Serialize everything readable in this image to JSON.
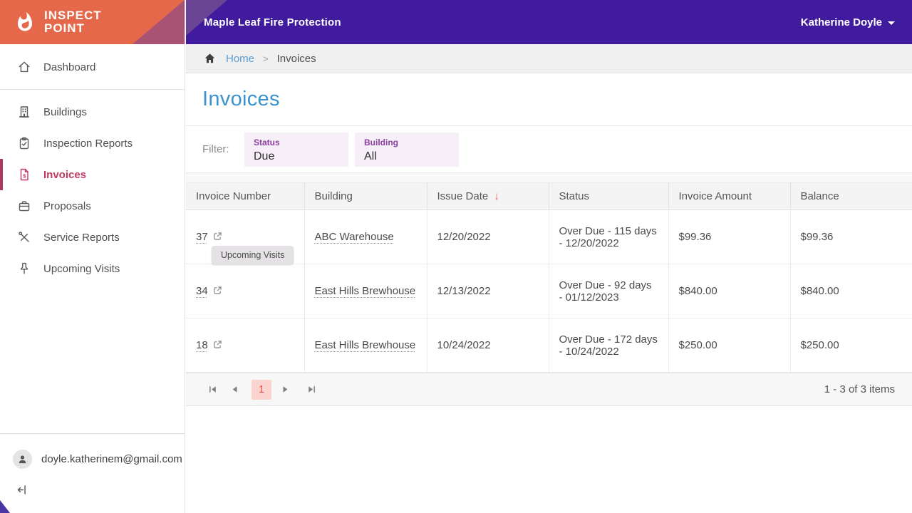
{
  "header": {
    "company": "Maple Leaf Fire Protection",
    "user_name": "Katherine Doyle"
  },
  "sidebar": {
    "logo_line1": "INSPECT",
    "logo_line2": "POINT",
    "items": [
      {
        "label": "Dashboard",
        "icon": "home-icon",
        "active": false
      },
      {
        "label": "Buildings",
        "icon": "building-icon",
        "active": false
      },
      {
        "label": "Inspection Reports",
        "icon": "clipboard-check-icon",
        "active": false
      },
      {
        "label": "Invoices",
        "icon": "invoice-document-icon",
        "active": true
      },
      {
        "label": "Proposals",
        "icon": "briefcase-icon",
        "active": false
      },
      {
        "label": "Service Reports",
        "icon": "tools-icon",
        "active": false
      },
      {
        "label": "Upcoming Visits",
        "icon": "pushpin-icon",
        "active": false
      }
    ],
    "user_email": "doyle.katherinem@gmail.com"
  },
  "breadcrumb": {
    "home": "Home",
    "separator": ">",
    "current": "Invoices"
  },
  "page": {
    "title": "Invoices"
  },
  "filter": {
    "label": "Filter:",
    "chips": [
      {
        "label": "Status",
        "value": "Due"
      },
      {
        "label": "Building",
        "value": "All"
      }
    ]
  },
  "table": {
    "columns": [
      "Invoice Number",
      "Building",
      "Issue Date",
      "Status",
      "Invoice Amount",
      "Balance"
    ],
    "sort": {
      "column": "Issue Date",
      "direction": "desc",
      "icon": "↓"
    },
    "rows": [
      {
        "invoice_number": "37",
        "building": "ABC Warehouse",
        "issue_date": "12/20/2022",
        "status": "Over Due - 115 days - 12/20/2022",
        "invoice_amount": "$99.36",
        "balance": "$99.36"
      },
      {
        "invoice_number": "34",
        "building": "East Hills Brewhouse",
        "issue_date": "12/13/2022",
        "status": "Over Due - 92 days - 01/12/2023",
        "invoice_amount": "$840.00",
        "balance": "$840.00"
      },
      {
        "invoice_number": "18",
        "building": "East Hills Brewhouse",
        "issue_date": "10/24/2022",
        "status": "Over Due - 172 days - 10/24/2022",
        "invoice_amount": "$250.00",
        "balance": "$250.00"
      }
    ]
  },
  "tooltip": {
    "text": "Upcoming Visits"
  },
  "pagination": {
    "current_page": "1",
    "summary": "1 - 3 of 3 items"
  },
  "colors": {
    "brand_orange": "#E5684B",
    "brand_purple": "#401B9D",
    "accent_crimson": "#C13A60",
    "title_blue": "#3A93CF",
    "overdue_red": "#E8574E",
    "active_page_bg": "#FBD3CF"
  }
}
